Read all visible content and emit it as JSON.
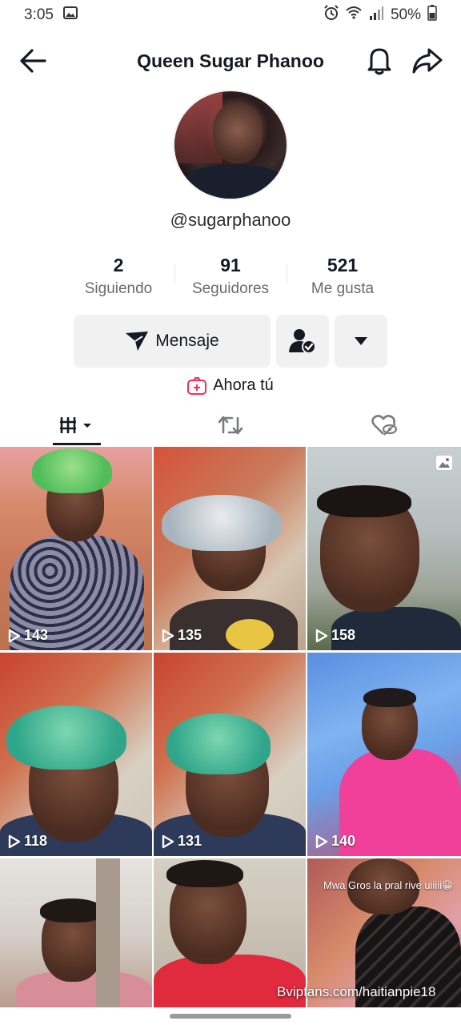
{
  "status_bar": {
    "time": "3:05",
    "battery": "50%"
  },
  "header": {
    "title": "Queen Sugar Phanoo"
  },
  "profile": {
    "username": "@sugarphanoo",
    "stats": [
      {
        "value": "2",
        "label": "Siguiendo"
      },
      {
        "value": "91",
        "label": "Seguidores"
      },
      {
        "value": "521",
        "label": "Me gusta"
      }
    ]
  },
  "actions": {
    "message_label": "Mensaje",
    "ahora_label": "Ahora tú"
  },
  "tabs": [
    {
      "name": "videos-grid",
      "icon": "grid-icon",
      "active": true
    },
    {
      "name": "reposts",
      "icon": "repost-icon",
      "active": false
    },
    {
      "name": "liked",
      "icon": "hidden-heart-icon",
      "active": false
    }
  ],
  "videos": [
    {
      "views": "143",
      "type": "video"
    },
    {
      "views": "135",
      "type": "video"
    },
    {
      "views": "158",
      "type": "photo"
    },
    {
      "views": "118",
      "type": "video"
    },
    {
      "views": "131",
      "type": "video"
    },
    {
      "views": "140",
      "type": "video"
    },
    {
      "views": "",
      "type": "video"
    },
    {
      "views": "",
      "type": "video"
    },
    {
      "views": "",
      "type": "video",
      "caption": "Mwa Gros la pral rive uiiiii😀"
    }
  ],
  "watermark": "Bvipfans.com/haitianpie18",
  "colors": {
    "text": "#161823",
    "button_bg": "#f1f1f2",
    "accent": "#fe2c55"
  }
}
